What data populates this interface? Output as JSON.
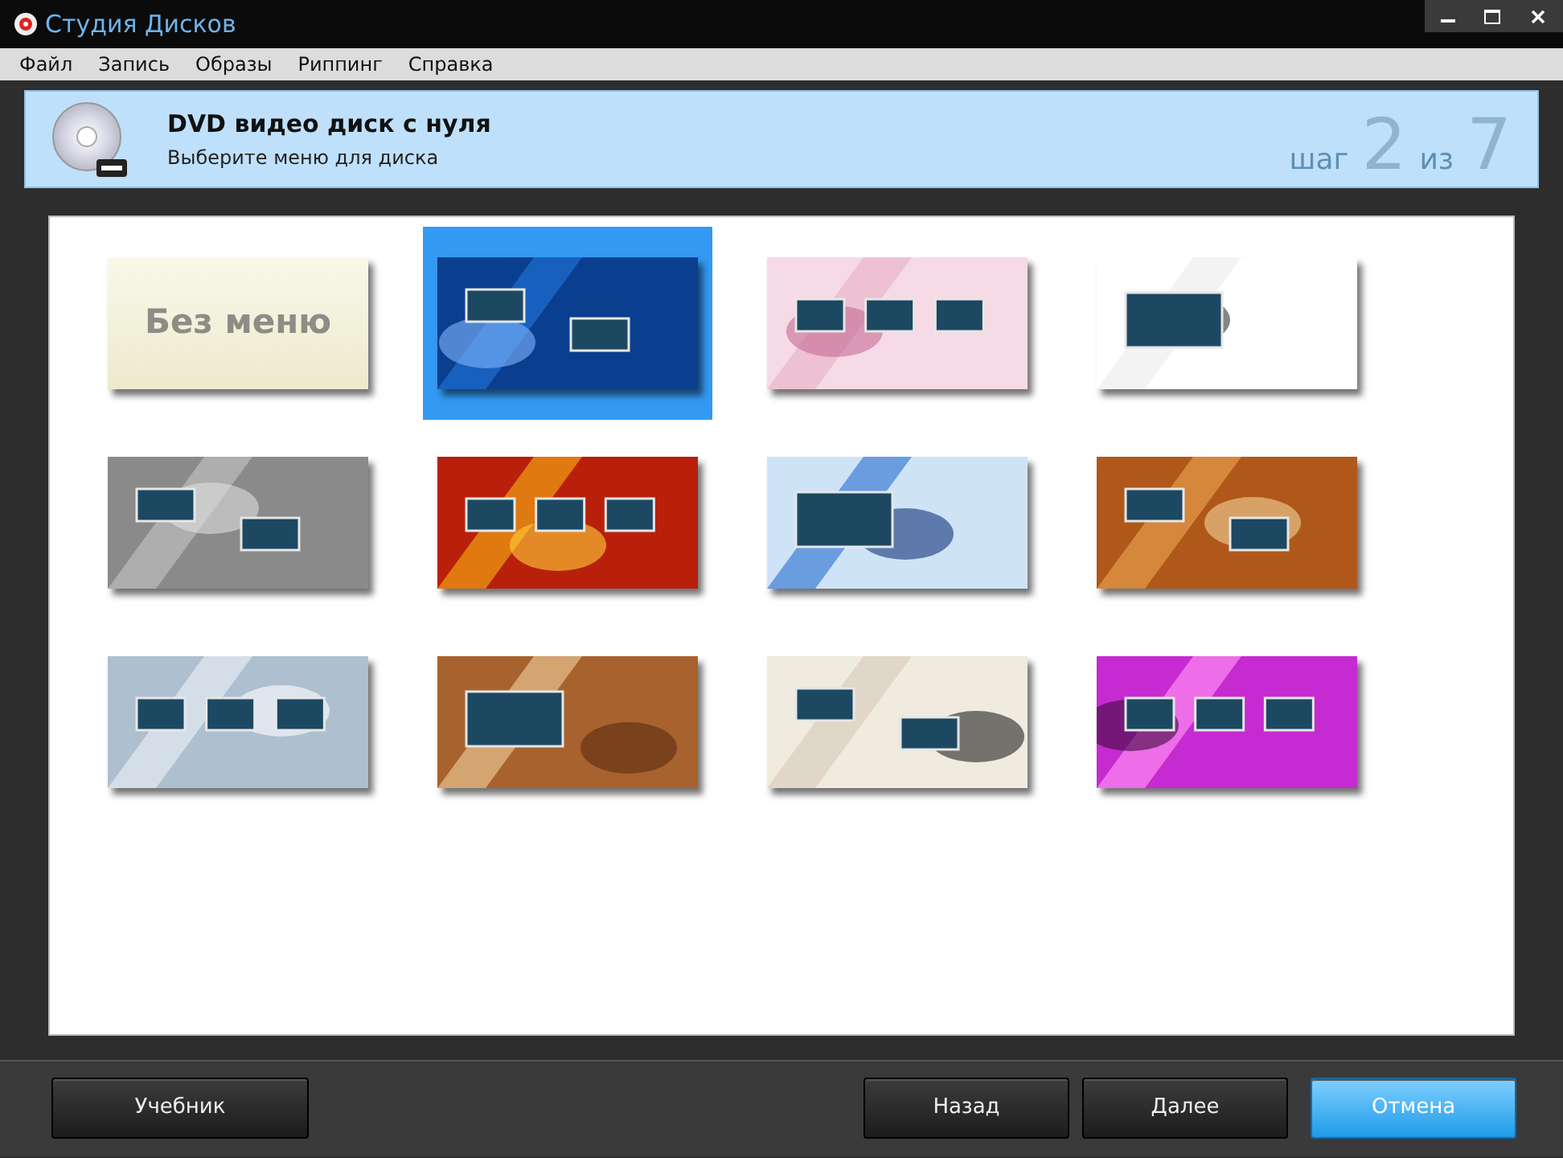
{
  "window": {
    "title": "Студия Дисков"
  },
  "menu": [
    "Файл",
    "Запись",
    "Образы",
    "Риппинг",
    "Справка"
  ],
  "header": {
    "title": "DVD видео диск с нуля",
    "subtitle": "Выберите меню для диска",
    "step_word": "шаг",
    "step": "2",
    "of_word": "из",
    "total": "7"
  },
  "templates": [
    {
      "kind": "no_menu",
      "label": "Без меню",
      "selected": false
    },
    {
      "kind": "picture",
      "selected": true
    },
    {
      "kind": "picture",
      "selected": false
    },
    {
      "kind": "picture",
      "selected": false
    },
    {
      "kind": "picture",
      "selected": false
    },
    {
      "kind": "picture",
      "selected": false
    },
    {
      "kind": "picture",
      "selected": false
    },
    {
      "kind": "picture",
      "selected": false
    },
    {
      "kind": "picture",
      "selected": false
    },
    {
      "kind": "picture",
      "selected": false
    },
    {
      "kind": "picture",
      "selected": false
    },
    {
      "kind": "picture",
      "selected": false
    }
  ],
  "left_buttons": [
    {
      "label": "Учебник",
      "highlighted": false
    }
  ],
  "right_buttons": [
    {
      "label": "Назад",
      "highlighted": false
    },
    {
      "label": "Далее",
      "highlighted": false
    },
    {
      "label": "Отмена",
      "highlighted": true
    }
  ]
}
